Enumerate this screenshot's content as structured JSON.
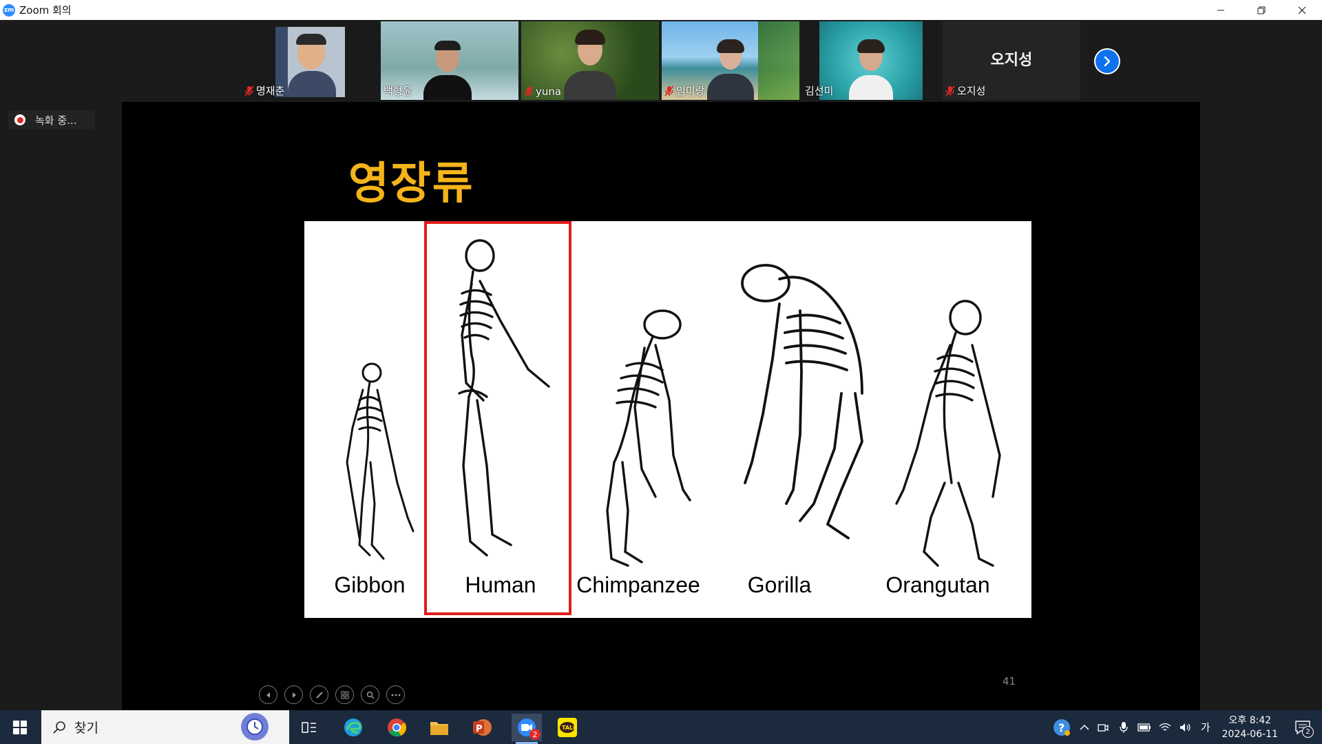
{
  "window": {
    "title": "Zoom 회의",
    "app_icon_text": "zm"
  },
  "gallery": {
    "participants": [
      {
        "name": "명재춘",
        "muted": true
      },
      {
        "name": "백형윤",
        "muted": false,
        "active_speaker": true
      },
      {
        "name": "yuna",
        "muted": true
      },
      {
        "name": "임미랑",
        "muted": true
      },
      {
        "name": "김선미",
        "muted": false
      },
      {
        "name": "오지성",
        "muted": true,
        "video_off": true
      }
    ],
    "video_off_display_name": "오지성"
  },
  "recording": {
    "label": "녹화 중..."
  },
  "slide": {
    "title": "영장류",
    "page_number": "41",
    "figure_labels": [
      "Gibbon",
      "Human",
      "Chimpanzee",
      "Gorilla",
      "Orangutan"
    ],
    "highlighted": "Human"
  },
  "taskbar": {
    "search_placeholder": "찾기",
    "zoom_badge": "2",
    "clock_time": "오후 8:42",
    "clock_date": "2024-06-11",
    "ime_label": "가",
    "notification_count": "2",
    "apps": [
      "task-view",
      "edge",
      "chrome",
      "file-explorer",
      "powerpoint",
      "zoom",
      "kakaotalk"
    ]
  },
  "colors": {
    "title_accent": "#f4b41a",
    "highlight_border": "#e21b1b",
    "zoom_blue": "#0e72ed",
    "taskbar": "#1c2a3e"
  }
}
